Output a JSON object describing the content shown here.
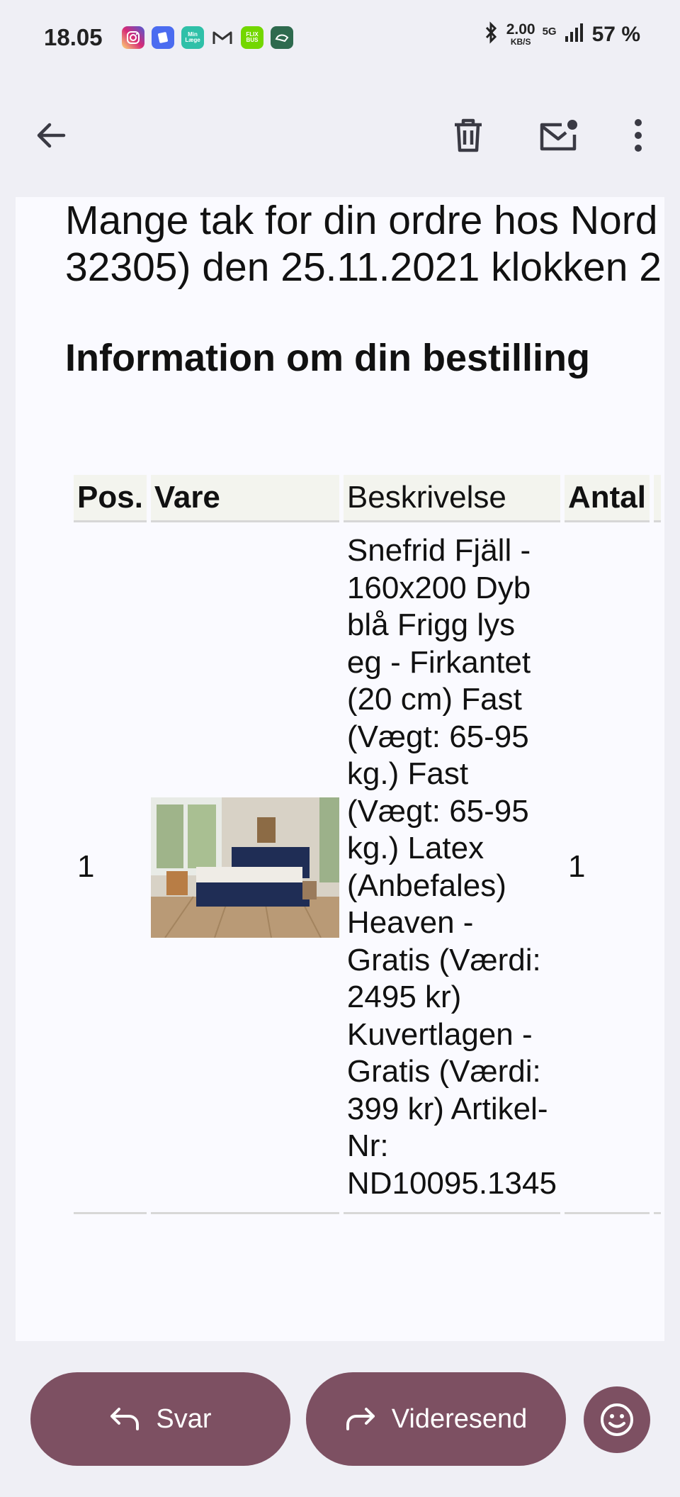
{
  "status_bar": {
    "time": "18.05",
    "apps": [
      {
        "name": "instagram-icon",
        "color": "#d62976",
        "label": ""
      },
      {
        "name": "app-blue-icon",
        "color": "#4b6cf0",
        "label": ""
      },
      {
        "name": "min-laege-icon",
        "color": "#2fc0a8",
        "label": "Min Læge"
      },
      {
        "name": "gmail-icon",
        "color": "#efeff5",
        "label": ""
      },
      {
        "name": "flixbus-icon",
        "color": "#73d700",
        "label": "FLIX BUS"
      },
      {
        "name": "app-green-icon",
        "color": "#2e6a4e",
        "label": ""
      }
    ],
    "net_speed_value": "2.00",
    "net_speed_unit": "KB/S",
    "network": "5G",
    "battery": "57 %"
  },
  "email": {
    "intro_line1": "Mange tak for din ordre hos Nord",
    "intro_line2": "32305) den 25.11.2021 klokken 2",
    "section_heading": "Information om din bestilling",
    "table": {
      "headers": {
        "pos": "Pos.",
        "vare": "Vare",
        "desc": "Beskrivelse",
        "antal": "Antal"
      },
      "rows": [
        {
          "pos": "1",
          "description": "Snefrid Fjäll - 160x200 Dyb blå Frigg lys eg - Firkantet (20 cm) Fast (Vægt: 65-95 kg.) Fast (Vægt: 65-95 kg.) Latex (Anbefales) Heaven - Gratis (Værdi: 2495 kr) Kuvertlagen - Gratis (Værdi: 399 kr) Artikel-Nr: ND10095.1345",
          "antal": "1"
        }
      ]
    }
  },
  "actions": {
    "reply_label": "Svar",
    "forward_label": "Videresend"
  },
  "colors": {
    "accent": "#7d5062",
    "background": "#efeff5",
    "card": "#fafaff",
    "table_header_bg": "#f3f4ee"
  }
}
